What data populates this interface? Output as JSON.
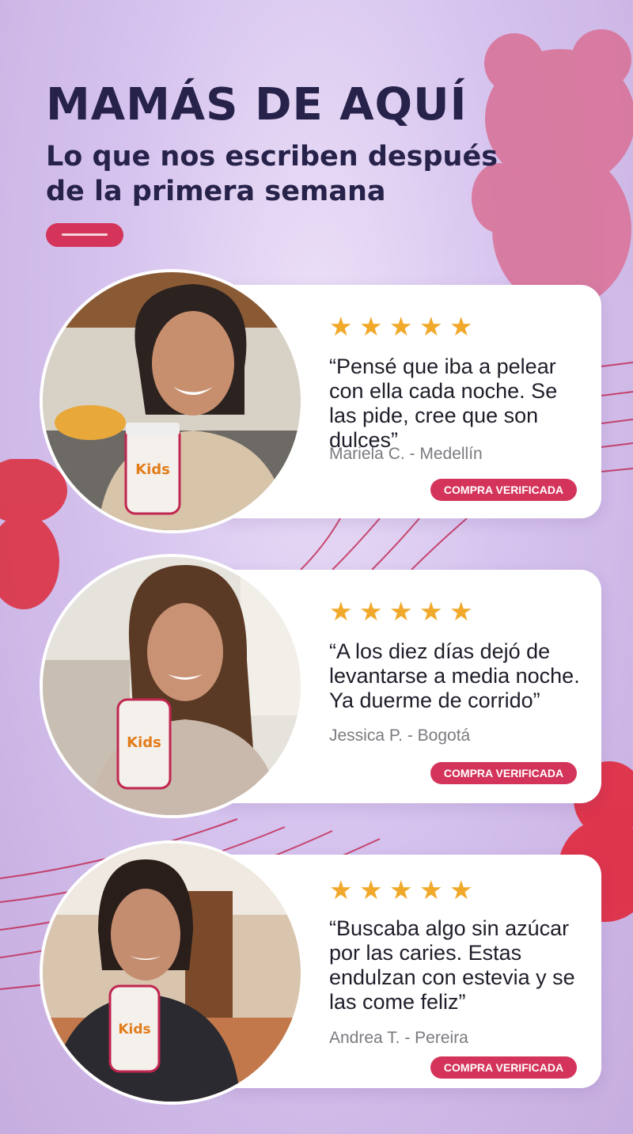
{
  "header": {
    "title": "MAMÁS DE AQUÍ",
    "subtitle": "Lo que nos escriben después de la primera semana"
  },
  "colors": {
    "accent": "#d4345a",
    "star": "#f0a92a",
    "heading": "#26224a"
  },
  "testimonials": [
    {
      "rating": 5,
      "quote": "“Pensé que iba a pelear con ella cada noche. Se las pide, cree que son dulces”",
      "author": "Mariela C. - Medellín",
      "badge": "COMPRA VERIFICADA"
    },
    {
      "rating": 5,
      "quote": "“A los diez días dejó de levantarse a media noche. Ya duerme de corrido”",
      "author": "Jessica P. - Bogotá",
      "badge": "COMPRA VERIFICADA"
    },
    {
      "rating": 5,
      "quote": "“Buscaba algo sin azúcar por las caries. Estas endulzan con estevia y se las come feliz”",
      "author": "Andrea T. - Pereira",
      "badge": "COMPRA VERIFICADA"
    }
  ],
  "product": {
    "label": "Kids"
  }
}
